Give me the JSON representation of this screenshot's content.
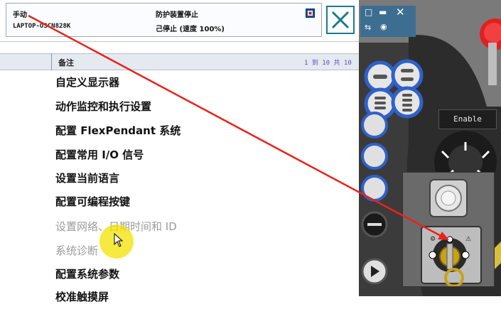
{
  "status": {
    "mode": "手动",
    "controller": "LAPTOP-OSCN828K",
    "state": "防护装置停止",
    "speed": "己停止 (速度 100%)"
  },
  "list": {
    "column_header": "备注",
    "paging": "1 到 10 共 10",
    "items": [
      {
        "label": "自定义显示器",
        "enabled": true
      },
      {
        "label": "动作监控和执行设置",
        "enabled": true
      },
      {
        "label": "配置 FlexPendant 系统",
        "enabled": true
      },
      {
        "label": "配置常用 I/O 信号",
        "enabled": true
      },
      {
        "label": "设置当前语言",
        "enabled": true
      },
      {
        "label": "配置可编程按键",
        "enabled": true
      },
      {
        "label": "设置网络、日期时间和 ID",
        "enabled": false
      },
      {
        "label": "系统诊断",
        "enabled": false
      },
      {
        "label": "配置系统参数",
        "enabled": true
      },
      {
        "label": "校准触摸屏",
        "enabled": true
      }
    ]
  },
  "pendant": {
    "enable_label": "Enable"
  },
  "colors": {
    "accent": "#1a7a8c",
    "panel_blue": "#3d6e91",
    "arrow_red": "#e8231c",
    "highlight": "#f3e200"
  },
  "icons": [
    "close-icon",
    "window-restore-icon",
    "minimize-icon",
    "lock-icon",
    "run-icon",
    "step-icon",
    "play-icon",
    "key-switch-icon"
  ]
}
